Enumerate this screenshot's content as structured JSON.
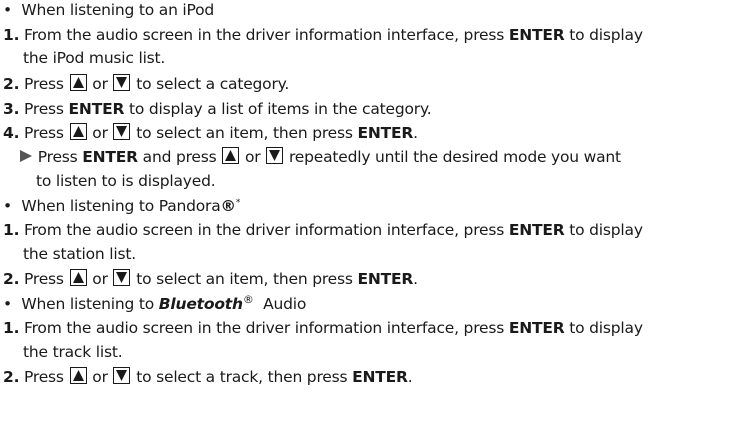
{
  "sections": [
    {
      "bullet": "•",
      "heading": "When listening to an iPod"
    },
    {
      "bullet": "•",
      "heading": "When listening to Pandora",
      "heading_mark": "®",
      "heading_sup": "*"
    },
    {
      "bullet": "•",
      "heading_italic": "Bluetooth",
      "heading_mark": "®",
      "heading_rest": "Audio",
      "heading_prefix": "When listening to"
    }
  ],
  "steps": {
    "s1_num": "1.",
    "s1_a": "From the audio screen in the driver information interface, press",
    "enter": "ENTER",
    "s1_b": "to display",
    "s1_c": "the iPod music list.",
    "s2_num": "2.",
    "press": "Press",
    "or": "or",
    "s2_b": "to select a category.",
    "s3_num": "3.",
    "s3_b": "to display a list of items in the category.",
    "s4_num": "4.",
    "s4_b": "to select an item, then press",
    "sub_b": "and press",
    "sub_c": "repeatedly until the desired mode you want",
    "sub_d": "to listen to is displayed.",
    "p1_c": "the station list.",
    "b1_c": "the track list.",
    "b2_b": "to select a track, then press",
    "period": "."
  }
}
